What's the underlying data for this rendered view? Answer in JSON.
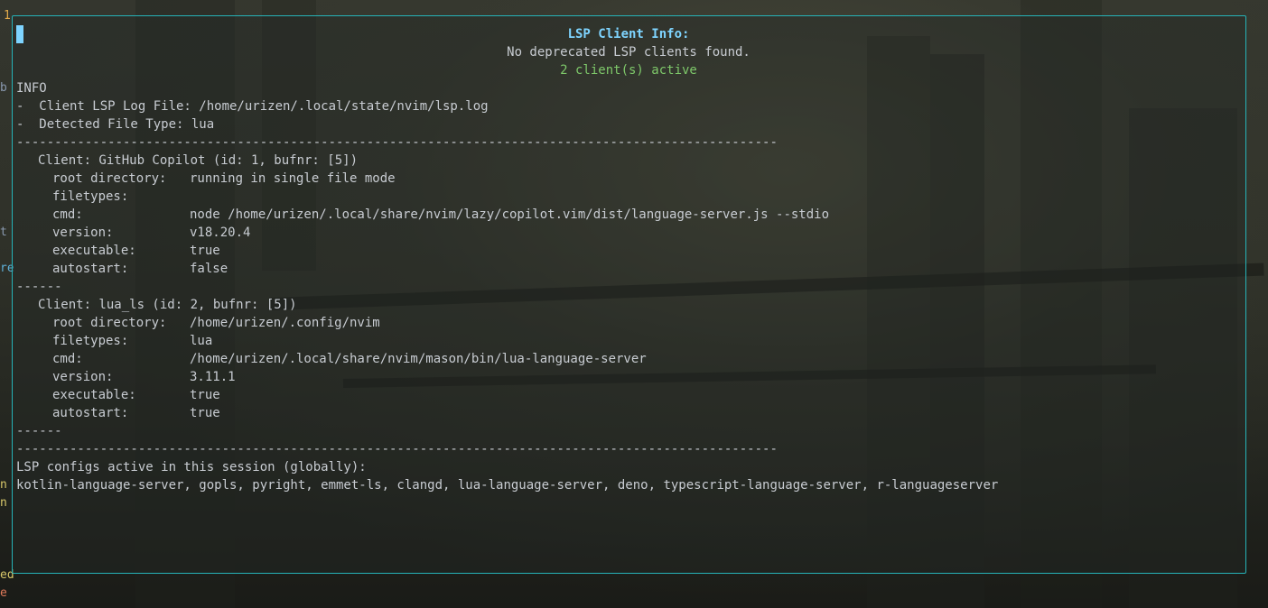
{
  "gutter": {
    "line_number": "1",
    "chars": [
      "b",
      "t",
      "re",
      "n",
      "n",
      "ed",
      "e"
    ]
  },
  "header": {
    "title": "LSP Client Info:",
    "deprecated_notice": "No deprecated LSP clients found.",
    "active_count": "2 client(s) active"
  },
  "info": {
    "level": "INFO",
    "log_file": "-  Client LSP Log File: /home/urizen/.local/state/nvim/lsp.log",
    "file_type": "-  Detected File Type: lua"
  },
  "separator_long": "----------------------------------------------------------------------------------------------------",
  "separator_short": "------",
  "clients": [
    {
      "heading": "Client: GitHub Copilot (id: 1, bufnr: [5])",
      "fields": [
        {
          "key": "root directory:",
          "value": "running in single file mode"
        },
        {
          "key": "filetypes:",
          "value": ""
        },
        {
          "key": "cmd:",
          "value": "node /home/urizen/.local/share/nvim/lazy/copilot.vim/dist/language-server.js --stdio"
        },
        {
          "key": "version:",
          "value": "v18.20.4"
        },
        {
          "key": "executable:",
          "value": "true"
        },
        {
          "key": "autostart:",
          "value": "false"
        }
      ]
    },
    {
      "heading": "Client: lua_ls (id: 2, bufnr: [5])",
      "fields": [
        {
          "key": "root directory:",
          "value": "/home/urizen/.config/nvim"
        },
        {
          "key": "filetypes:",
          "value": "lua"
        },
        {
          "key": "cmd:",
          "value": "/home/urizen/.local/share/nvim/mason/bin/lua-language-server"
        },
        {
          "key": "version:",
          "value": "3.11.1"
        },
        {
          "key": "executable:",
          "value": "true"
        },
        {
          "key": "autostart:",
          "value": "true"
        }
      ]
    }
  ],
  "configs": {
    "label": "LSP configs active in this session (globally):",
    "list": "kotlin-language-server, gopls, pyright, emmet-ls, clangd, lua-language-server, deno, typescript-language-server, r-languageserver"
  },
  "colors": {
    "border": "#26b3b8",
    "title": "#7ed4ff",
    "active": "#7ec86a",
    "text": "#c8ccd2",
    "line_number": "#e0a84a"
  }
}
